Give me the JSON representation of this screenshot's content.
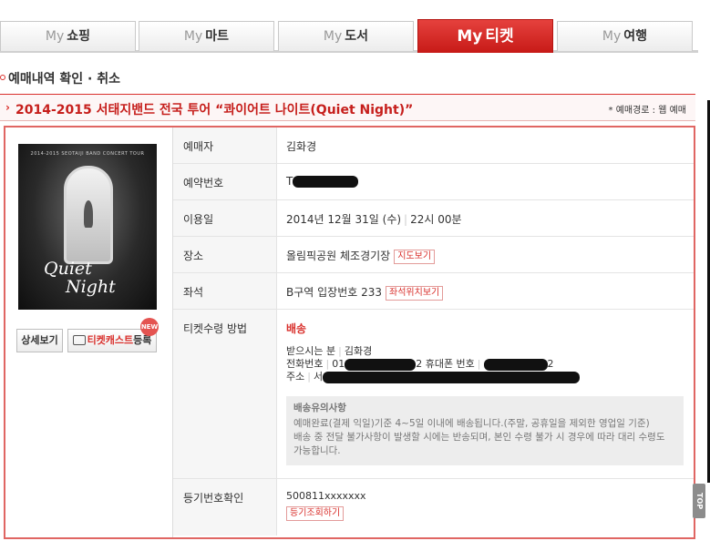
{
  "tabs": [
    {
      "my": "My",
      "label": "쇼핑"
    },
    {
      "my": "My",
      "label": "마트"
    },
    {
      "my": "My",
      "label": "도서"
    },
    {
      "my": "My",
      "label": "티켓",
      "active": true
    },
    {
      "my": "My",
      "label": "여행"
    }
  ],
  "section_title": "예매내역 확인 · 취소",
  "concert": {
    "arrow": "›",
    "title": "2014-2015 서태지밴드 전국 투어 “콰이어트 나이트(Quiet Night)”",
    "route": "* 예매경로 : 웹 예매"
  },
  "poster": {
    "top_text": "2014-2015 SEOTAIJI BAND CONCERT TOUR",
    "quiet": "Quiet",
    "night": "Night"
  },
  "buttons": {
    "detail": "상세보기",
    "cast_red": "티켓캐스트",
    "cast_rest": "등록",
    "new_badge": "NEW"
  },
  "rows": {
    "booker": {
      "label": "예매자",
      "value": "김화경"
    },
    "reservation": {
      "label": "예약번호",
      "value": "T"
    },
    "date": {
      "label": "이용일",
      "date": "2014년 12월 31일 (수)",
      "sep": "|",
      "time": "22시 00분"
    },
    "place": {
      "label": "장소",
      "value": "올림픽공원 체조경기장",
      "button": "지도보기"
    },
    "seat": {
      "label": "좌석",
      "value": "B구역 입장번호 233",
      "button": "좌석위치보기"
    },
    "method": {
      "label": "티켓수령 방법",
      "title": "배송",
      "recipient_label": "받으시는 분",
      "recipient": "김화경",
      "phone_label": "전화번호",
      "phone_prefix": "01",
      "mobile_label": "2 휴대폰 번호",
      "mobile_suffix": "2",
      "address_label": "주소",
      "address_prefix": "서",
      "notice_title": "배송유의사항",
      "notice_1": "예매완료(결제 익일)기준 4~5일 이내에 배송됩니다.(주말, 공휴일을 제외한 영업일 기준)",
      "notice_2": "배송 중 전달 불가사항이 발생할 시에는 반송되며, 본인 수령 불가 시 경우에 따라 대리 수령도 가능합니다."
    },
    "registered": {
      "label": "등기번호확인",
      "value": "500811xxxxxxx",
      "button": "등기조회하기"
    }
  },
  "top_button": "TOP"
}
